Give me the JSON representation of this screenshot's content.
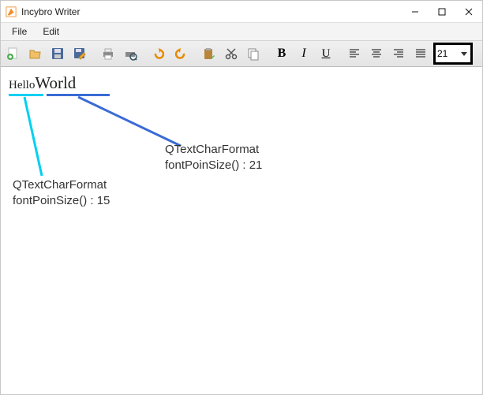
{
  "window": {
    "title": "Incybro Writer"
  },
  "menubar": {
    "file": "File",
    "edit": "Edit"
  },
  "toolbar": {
    "fontsize_value": "21"
  },
  "document": {
    "word1": "Hello",
    "word2": "World"
  },
  "annotations": {
    "anno1_line1": "QTextCharFormat",
    "anno1_line2": "fontPoinSize() : 15",
    "anno2_line1": "QTextCharFormat",
    "anno2_line2": "fontPoinSize() : 21"
  }
}
